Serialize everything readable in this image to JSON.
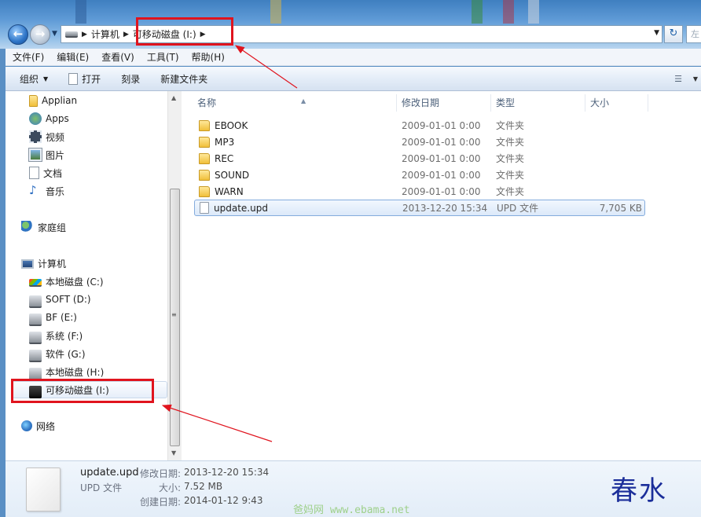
{
  "address_bar": {
    "crumbs": [
      "计算机",
      "可移动磁盘 (I:)"
    ],
    "search_stub": "左"
  },
  "menu": [
    "文件(F)",
    "编辑(E)",
    "查看(V)",
    "工具(T)",
    "帮助(H)"
  ],
  "toolbar": {
    "organize": "组织",
    "open": "打开",
    "burn": "刻录",
    "new_folder": "新建文件夹"
  },
  "nav": {
    "libraries": [
      {
        "label": "Applian",
        "icon": "folder-icon"
      },
      {
        "label": "Apps",
        "icon": "apps-icon"
      },
      {
        "label": "视频",
        "icon": "video-icon"
      },
      {
        "label": "图片",
        "icon": "picture-icon"
      },
      {
        "label": "文档",
        "icon": "document-icon"
      },
      {
        "label": "音乐",
        "icon": "music-icon"
      }
    ],
    "homegroup": "家庭组",
    "computer": "计算机",
    "drives": [
      "本地磁盘 (C:)",
      "SOFT (D:)",
      "BF (E:)",
      "系统 (F:)",
      "软件 (G:)",
      "本地磁盘 (H:)",
      "可移动磁盘 (I:)"
    ],
    "network": "网络"
  },
  "columns": {
    "name": "名称",
    "modified": "修改日期",
    "type": "类型",
    "size": "大小"
  },
  "files": [
    {
      "name": "EBOOK",
      "modified": "2009-01-01 0:00",
      "type": "文件夹",
      "size": "",
      "kind": "folder"
    },
    {
      "name": "MP3",
      "modified": "2009-01-01 0:00",
      "type": "文件夹",
      "size": "",
      "kind": "folder"
    },
    {
      "name": "REC",
      "modified": "2009-01-01 0:00",
      "type": "文件夹",
      "size": "",
      "kind": "folder"
    },
    {
      "name": "SOUND",
      "modified": "2009-01-01 0:00",
      "type": "文件夹",
      "size": "",
      "kind": "folder"
    },
    {
      "name": "WARN",
      "modified": "2009-01-01 0:00",
      "type": "文件夹",
      "size": "",
      "kind": "folder"
    },
    {
      "name": "update.upd",
      "modified": "2013-12-20 15:34",
      "type": "UPD 文件",
      "size": "7,705 KB",
      "kind": "file"
    }
  ],
  "details": {
    "name": "update.upd",
    "type": "UPD 文件",
    "modified_label": "修改日期:",
    "modified": "2013-12-20 15:34",
    "size_label": "大小:",
    "size": "7.52 MB",
    "created_label": "创建日期:",
    "created": "2014-01-12 9:43"
  },
  "watermark": {
    "signature": "春水",
    "site": "爸妈网 www.ebama.net"
  },
  "colors": {
    "highlight_red": "#e0141e",
    "selection_border": "#84acdd"
  }
}
